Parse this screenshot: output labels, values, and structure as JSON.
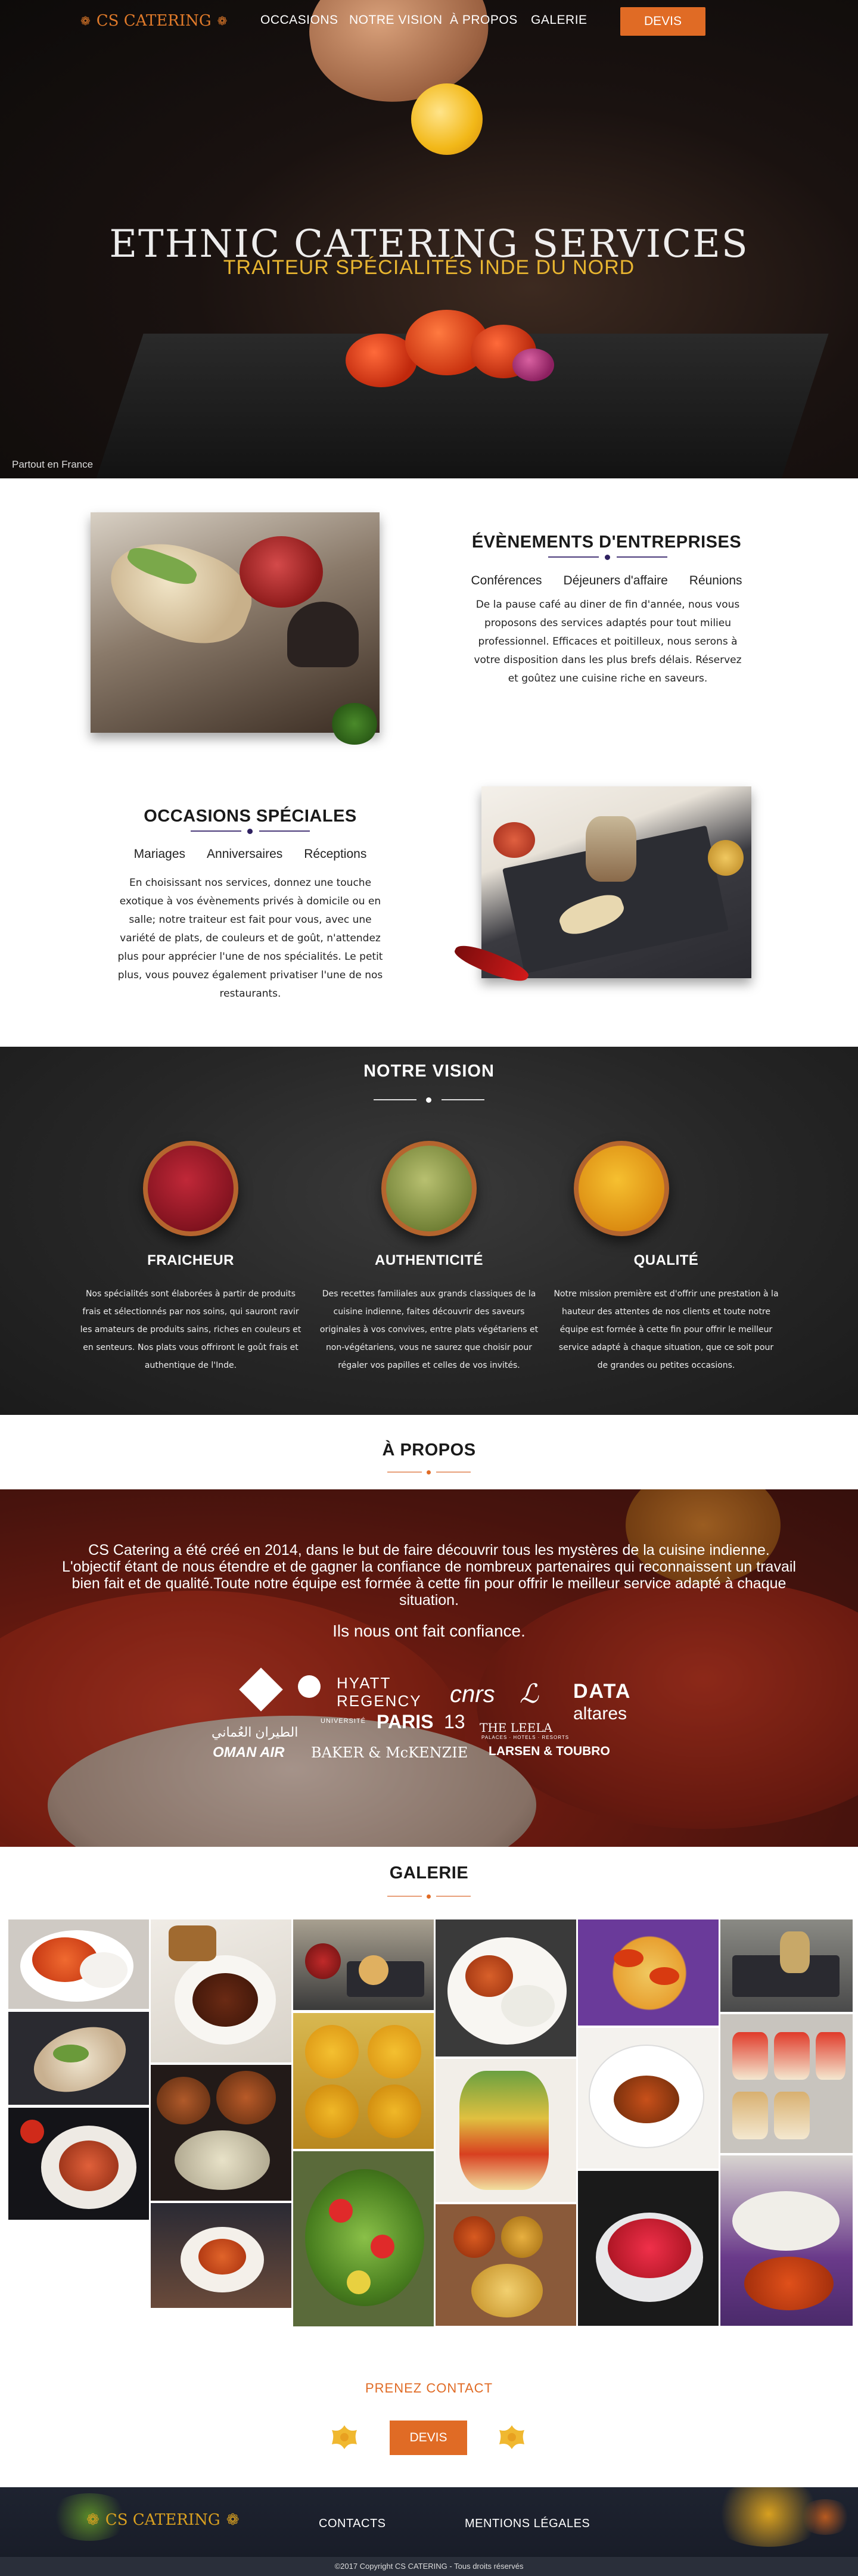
{
  "nav": {
    "brand": "CS CATERING",
    "items": [
      "OCCASIONS",
      "NOTRE VISION",
      "À PROPOS",
      "GALERIE"
    ],
    "cta": "DEVIS"
  },
  "hero": {
    "title": "ETHNIC CATERING SERVICES",
    "subtitle": "TRAITEUR SPÉCIALITÉS INDE DU NORD",
    "location": "Partout en France"
  },
  "entreprises": {
    "title": "ÉVÈNEMENTS D'ENTREPRISES",
    "tags": [
      "Conférences",
      "Déjeuners d'affaire",
      "Réunions"
    ],
    "text": "De la pause café au diner de fin d'année, nous vous proposons des services adaptés pour tout milieu professionnel. Efficaces et poitilleux, nous serons à votre disposition dans les plus brefs délais. Réservez et goûtez une cuisine riche en saveurs."
  },
  "speciales": {
    "title": "OCCASIONS SPÉCIALES",
    "tags": [
      "Mariages",
      "Anniversaires",
      "Réceptions"
    ],
    "text": "En choisissant nos services, donnez une touche exotique à vos évènements privés à domicile ou en salle; notre traiteur est fait pour vous, avec une variété de plats, de couleurs et de goût, n'attendez plus pour apprécier l'une de nos spécialités. Le petit plus, vous pouvez également privatiser l'une de nos restaurants."
  },
  "vision": {
    "title": "NOTRE VISION",
    "items": [
      {
        "title": "FRAICHEUR",
        "text": "Nos spécialités sont élaborées à partir de produits frais et sélectionnés par nos soins, qui sauront ravir les amateurs de produits sains, riches en couleurs et en senteurs. Nos plats vous offriront le goût frais et authentique de l'Inde."
      },
      {
        "title": "AUTHENTICITÉ",
        "text": "Des recettes familiales aux grands classiques de la cuisine indienne, faites découvrir des saveurs originales à vos convives, entre plats végétariens et non-végétariens, vous ne saurez que choisir pour régaler vos papilles et celles de vos invités."
      },
      {
        "title": "QUALITÉ",
        "text": "Notre mission première est d'offrir une prestation à la hauteur des attentes de nos clients et toute notre équipe est formée à cette fin pour offrir le meilleur service adapté à chaque situation, que ce soit pour de grandes ou petites occasions."
      }
    ],
    "colors": {
      "fraicheur": "#9c1c28",
      "authenticite": "#7a8a3a",
      "qualite": "#e8a21a"
    }
  },
  "apropos": {
    "title": "À PROPOS",
    "text": "CS Catering a été créé en 2014, dans le but de faire découvrir tous les mystères de la cuisine indienne. L'objectif étant de nous étendre et de gagner la confiance de nombreux partenaires qui reconnaissent un travail bien fait et de qualité.Toute notre équipe est formée à cette fin pour offrir le meilleur service adapté à chaque situation.",
    "confiance": "Ils nous ont fait confiance.",
    "logos": {
      "hyatt_1": "HYATT",
      "hyatt_2": "REGENCY",
      "paris_1": "UNIVERSITÉ",
      "paris_2": "PARIS",
      "paris_3": "13",
      "cnrs": "cnrs",
      "leela_1": "THE LEELA",
      "leela_2": "PALACES · HOTELS · RESORTS",
      "data_1": "DATA",
      "data_2": "altares",
      "oman_ar": "الطيران العُماني",
      "oman_en": "OMAN AIR",
      "baker": "BAKER & McKENZIE",
      "larsen": "LARSEN & TOUBRO"
    }
  },
  "galerie": {
    "title": "GALERIE"
  },
  "contact": {
    "title": "PRENEZ CONTACT",
    "cta": "DEVIS"
  },
  "footer": {
    "brand": "CS CATERING",
    "links": [
      "CONTACTS",
      "MENTIONS LÉGALES"
    ],
    "copyright": "©2017 Copyright CS CATERING - Tous droits réservés"
  },
  "colors": {
    "accent": "#e06b25",
    "brand_gold": "#e8b530",
    "divider_purple": "#2e2060",
    "footer_bg": "#1e2330"
  },
  "icons": [
    "lotus-ornament-icon",
    "chili-pepper-icon",
    "herb-sprig-icon"
  ]
}
